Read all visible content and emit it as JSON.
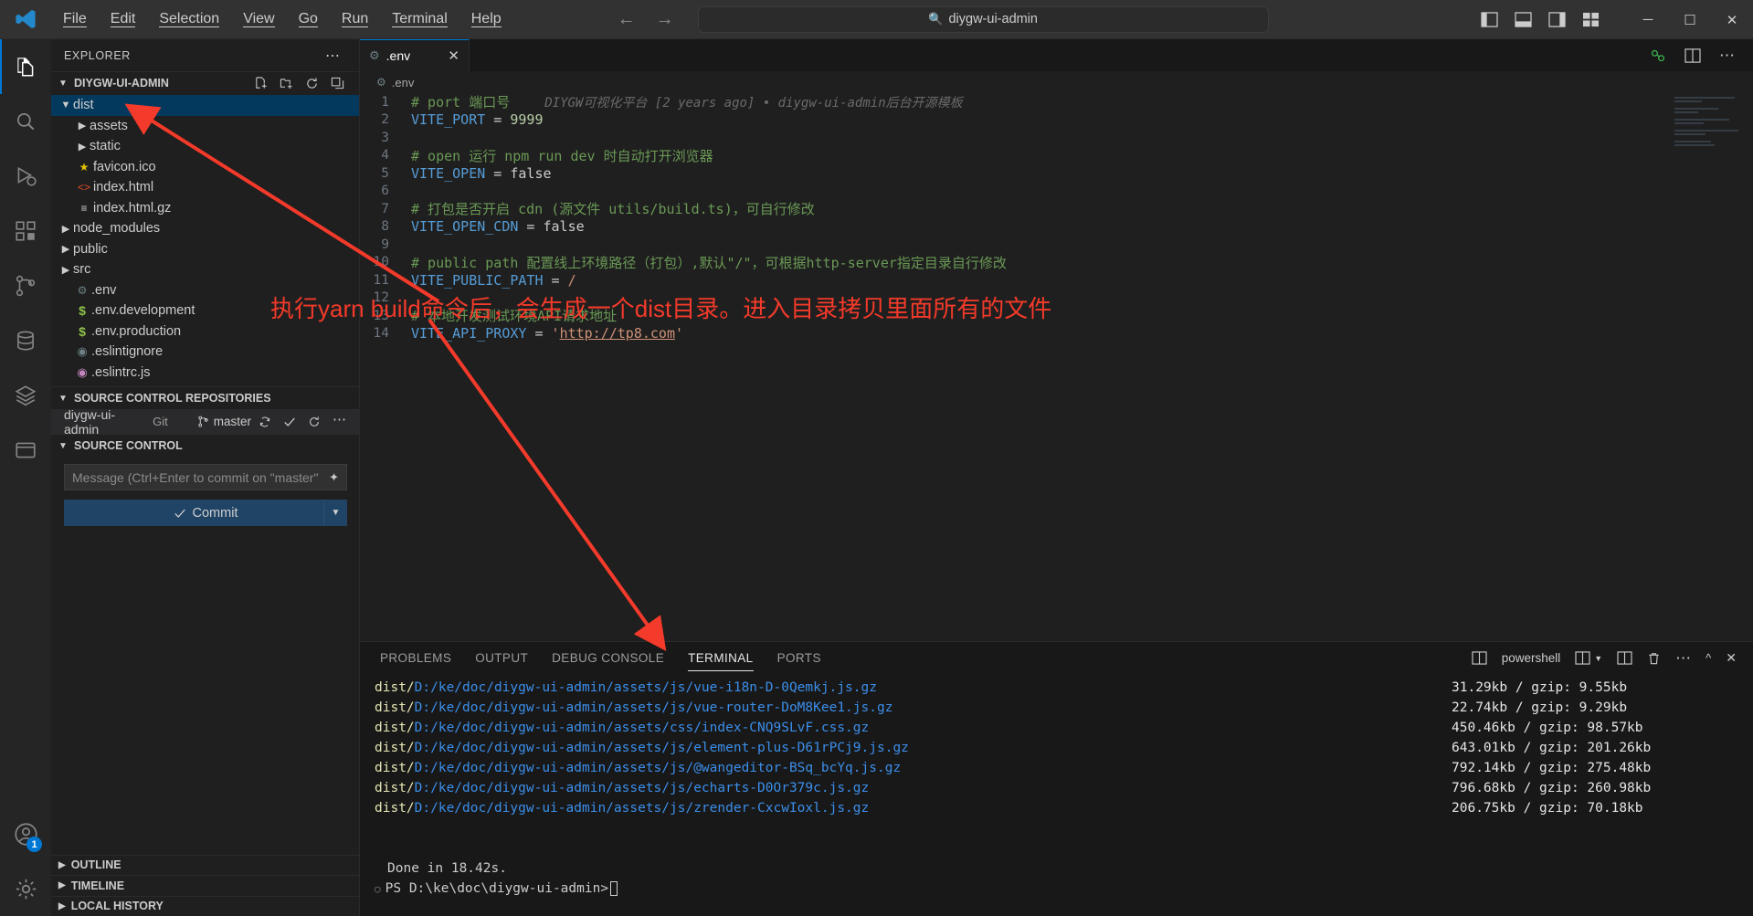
{
  "titlebar": {
    "logo_icon": "vscode-logo-icon",
    "menus": [
      "File",
      "Edit",
      "Selection",
      "View",
      "Go",
      "Run",
      "Terminal",
      "Help"
    ],
    "nav_back_icon": "arrow-left-icon",
    "nav_forward_icon": "arrow-right-icon",
    "search": {
      "icon": "search-icon",
      "value": "diygw-ui-admin"
    },
    "layout_icons": [
      "panel-left-icon",
      "panel-bottom-icon",
      "panel-right-icon",
      "layout-grid-icon"
    ],
    "window_controls": {
      "minimize": "─",
      "maximize": "☐",
      "close": "✕"
    }
  },
  "activitybar": {
    "items": [
      {
        "name": "explorer",
        "icon": "files-icon",
        "active": true
      },
      {
        "name": "search",
        "icon": "search-icon",
        "active": false
      },
      {
        "name": "run-and-debug",
        "icon": "debug-icon",
        "active": false
      },
      {
        "name": "extensions",
        "icon": "extensions-icon",
        "active": false
      },
      {
        "name": "source-control",
        "icon": "source-control-icon",
        "active": false
      },
      {
        "name": "database",
        "icon": "database-icon",
        "active": false
      },
      {
        "name": "layers",
        "icon": "layers-icon",
        "active": false
      },
      {
        "name": "remote-explorer",
        "icon": "remote-window-icon",
        "active": false
      }
    ],
    "accounts": {
      "icon": "account-icon",
      "badge": "1"
    },
    "settings": {
      "icon": "gear-icon"
    }
  },
  "sidebar": {
    "title": "EXPLORER",
    "more_icon": "ellipsis-icon",
    "explorer": {
      "root_label": "DIYGW-UI-ADMIN",
      "actions": [
        "new-file-icon",
        "new-folder-icon",
        "refresh-icon",
        "collapse-all-icon"
      ],
      "tree": [
        {
          "label": "dist",
          "type": "folder",
          "indent": 1,
          "expanded": true,
          "selected": true,
          "icon": "chevron-down-icon"
        },
        {
          "label": "assets",
          "type": "folder",
          "indent": 2,
          "expanded": false,
          "selected": false,
          "icon": "chevron-right-icon"
        },
        {
          "label": "static",
          "type": "folder",
          "indent": 2,
          "expanded": false,
          "selected": false,
          "icon": "chevron-right-icon"
        },
        {
          "label": "favicon.ico",
          "type": "file",
          "indent": 2,
          "icon": "star-icon",
          "color": "#e5c200"
        },
        {
          "label": "index.html",
          "type": "file",
          "indent": 2,
          "icon": "html-icon",
          "color": "#e44d26"
        },
        {
          "label": "index.html.gz",
          "type": "file",
          "indent": 2,
          "icon": "archive-icon",
          "color": "#cccccc"
        },
        {
          "label": "node_modules",
          "type": "folder",
          "indent": 1,
          "expanded": false,
          "icon": "chevron-right-icon"
        },
        {
          "label": "public",
          "type": "folder",
          "indent": 1,
          "expanded": false,
          "icon": "chevron-right-icon"
        },
        {
          "label": "src",
          "type": "folder",
          "indent": 1,
          "expanded": false,
          "icon": "chevron-right-icon"
        },
        {
          "label": ".env",
          "type": "file",
          "indent": 1,
          "icon": "gear-icon",
          "color": "#6d8086"
        },
        {
          "label": ".env.development",
          "type": "file",
          "indent": 1,
          "icon": "dollar-icon",
          "color": "#8dc149"
        },
        {
          "label": ".env.production",
          "type": "file",
          "indent": 1,
          "icon": "dollar-icon",
          "color": "#8dc149"
        },
        {
          "label": ".eslintignore",
          "type": "file",
          "indent": 1,
          "icon": "eslint-icon",
          "color": "#6d8086"
        },
        {
          "label": ".eslintrc.js",
          "type": "file",
          "indent": 1,
          "icon": "eslint-icon",
          "color": "#c586c0"
        }
      ]
    },
    "source_control_repositories": {
      "header": "SOURCE CONTROL REPOSITORIES",
      "repo_name": "diygw-ui-admin",
      "repo_kind": "Git",
      "branch_icon": "git-branch-icon",
      "branch": "master",
      "sync_icon": "sync-icon",
      "check_icon": "check-icon",
      "refresh_icon": "refresh-icon",
      "more_icon": "ellipsis-icon"
    },
    "source_control": {
      "header": "SOURCE CONTROL",
      "message_placeholder": "Message (Ctrl+Enter to commit on \"master\")",
      "sparkle_icon": "sparkle-icon",
      "commit_label": "Commit",
      "commit_check_icon": "check-icon",
      "commit_dropdown_icon": "chevron-down-icon"
    },
    "bottom_sections": [
      {
        "label": "OUTLINE",
        "icon": "chevron-right-icon"
      },
      {
        "label": "TIMELINE",
        "icon": "chevron-right-icon"
      },
      {
        "label": "LOCAL HISTORY",
        "icon": "chevron-right-icon"
      }
    ]
  },
  "editor": {
    "tab": {
      "label": ".env",
      "icon": "gear-icon",
      "close_icon": "close-icon"
    },
    "tab_actions": [
      "split-editor-icon",
      "more-actions-icon"
    ],
    "editor_right_icons": [
      "live-share-icon",
      "split-editor-icon",
      "ellipsis-icon"
    ],
    "breadcrumb": {
      "icon": "gear-icon",
      "label": ".env"
    },
    "blame_annotation": "DIYGW可视化平台 [2 years ago] • diygw-ui-admin后台开源模板",
    "lines": [
      {
        "n": 1,
        "tokens": [
          {
            "t": "# port 端口号",
            "c": "c-com"
          }
        ]
      },
      {
        "n": 2,
        "tokens": [
          {
            "t": "VITE_PORT",
            "c": "c-key"
          },
          {
            "t": " = ",
            "c": "c-op"
          },
          {
            "t": "9999",
            "c": "c-num"
          }
        ]
      },
      {
        "n": 3,
        "tokens": []
      },
      {
        "n": 4,
        "tokens": [
          {
            "t": "# open 运行 npm run dev 时自动打开浏览器",
            "c": "c-com"
          }
        ]
      },
      {
        "n": 5,
        "tokens": [
          {
            "t": "VITE_OPEN",
            "c": "c-key"
          },
          {
            "t": " = ",
            "c": "c-op"
          },
          {
            "t": "false",
            "c": "c-num"
          }
        ]
      },
      {
        "n": 6,
        "tokens": []
      },
      {
        "n": 7,
        "tokens": [
          {
            "t": "# 打包是否开启 cdn (源文件 utils/build.ts)，可自行修改",
            "c": "c-com"
          }
        ]
      },
      {
        "n": 8,
        "tokens": [
          {
            "t": "VITE_OPEN_CDN",
            "c": "c-key"
          },
          {
            "t": " = ",
            "c": "c-op"
          },
          {
            "t": "false",
            "c": "c-num"
          }
        ]
      },
      {
        "n": 9,
        "tokens": []
      },
      {
        "n": 10,
        "tokens": [
          {
            "t": "# public path 配置线上环境路径（打包）,默认\"/\"，可根据http-server指定目录自行修改",
            "c": "c-com"
          }
        ]
      },
      {
        "n": 11,
        "tokens": [
          {
            "t": "VITE_PUBLIC_PATH",
            "c": "c-key"
          },
          {
            "t": " = ",
            "c": "c-op"
          },
          {
            "t": "/",
            "c": "c-str"
          }
        ]
      },
      {
        "n": 12,
        "tokens": []
      },
      {
        "n": 13,
        "tokens": [
          {
            "t": "# 本地开发测试环境API请求地址",
            "c": "c-com"
          }
        ]
      },
      {
        "n": 14,
        "tokens": [
          {
            "t": "VITE_API_PROXY",
            "c": "c-key"
          },
          {
            "t": " = ",
            "c": "c-op"
          },
          {
            "t": "'",
            "c": "c-str"
          },
          {
            "t": "http://tp8.com",
            "c": "c-link"
          },
          {
            "t": "'",
            "c": "c-str"
          }
        ]
      }
    ]
  },
  "panel": {
    "tabs": [
      {
        "label": "PROBLEMS",
        "active": false
      },
      {
        "label": "OUTPUT",
        "active": false
      },
      {
        "label": "DEBUG CONSOLE",
        "active": false
      },
      {
        "label": "TERMINAL",
        "active": true
      },
      {
        "label": "PORTS",
        "active": false
      }
    ],
    "toolbar": {
      "terminal_icon": "terminal-split-icon",
      "terminal_name": "powershell",
      "new_terminal_icon": "new-terminal-icon",
      "dropdown_icon": "chevron-down-icon",
      "split_icon": "split-terminal-icon",
      "kill_icon": "trash-icon",
      "more_icon": "ellipsis-icon",
      "maximize_icon": "chevron-up-icon",
      "close_icon": "close-icon"
    },
    "terminal_lines": [
      {
        "prefix": "dist/",
        "path": "D:/ke/doc/diygw-ui-admin/assets/js/vue-i18n-D-0Qemkj.js.gz",
        "size": "31.29kb / gzip: 9.55kb"
      },
      {
        "prefix": "dist/",
        "path": "D:/ke/doc/diygw-ui-admin/assets/js/vue-router-DoM8Kee1.js.gz",
        "size": "22.74kb / gzip: 9.29kb"
      },
      {
        "prefix": "dist/",
        "path": "D:/ke/doc/diygw-ui-admin/assets/css/index-CNQ9SLvF.css.gz",
        "size": "450.46kb / gzip: 98.57kb"
      },
      {
        "prefix": "dist/",
        "path": "D:/ke/doc/diygw-ui-admin/assets/js/element-plus-D61rPCj9.js.gz",
        "size": "643.01kb / gzip: 201.26kb"
      },
      {
        "prefix": "dist/",
        "path": "D:/ke/doc/diygw-ui-admin/assets/js/@wangeditor-BSq_bcYq.js.gz",
        "size": "792.14kb / gzip: 275.48kb"
      },
      {
        "prefix": "dist/",
        "path": "D:/ke/doc/diygw-ui-admin/assets/js/echarts-D0Or379c.js.gz",
        "size": "796.68kb / gzip: 260.98kb"
      },
      {
        "prefix": "dist/",
        "path": "D:/ke/doc/diygw-ui-admin/assets/js/zrender-CxcwIoxl.js.gz",
        "size": "206.75kb / gzip: 70.18kb"
      }
    ],
    "done_line": "Done in 18.42s.",
    "prompt": "PS D:\\ke\\doc\\diygw-ui-admin>"
  },
  "annotations": {
    "color": "#f43a2a",
    "text": "执行yarn build命令后，会生成一个dist目录。进入目录拷贝里面所有的文件"
  }
}
